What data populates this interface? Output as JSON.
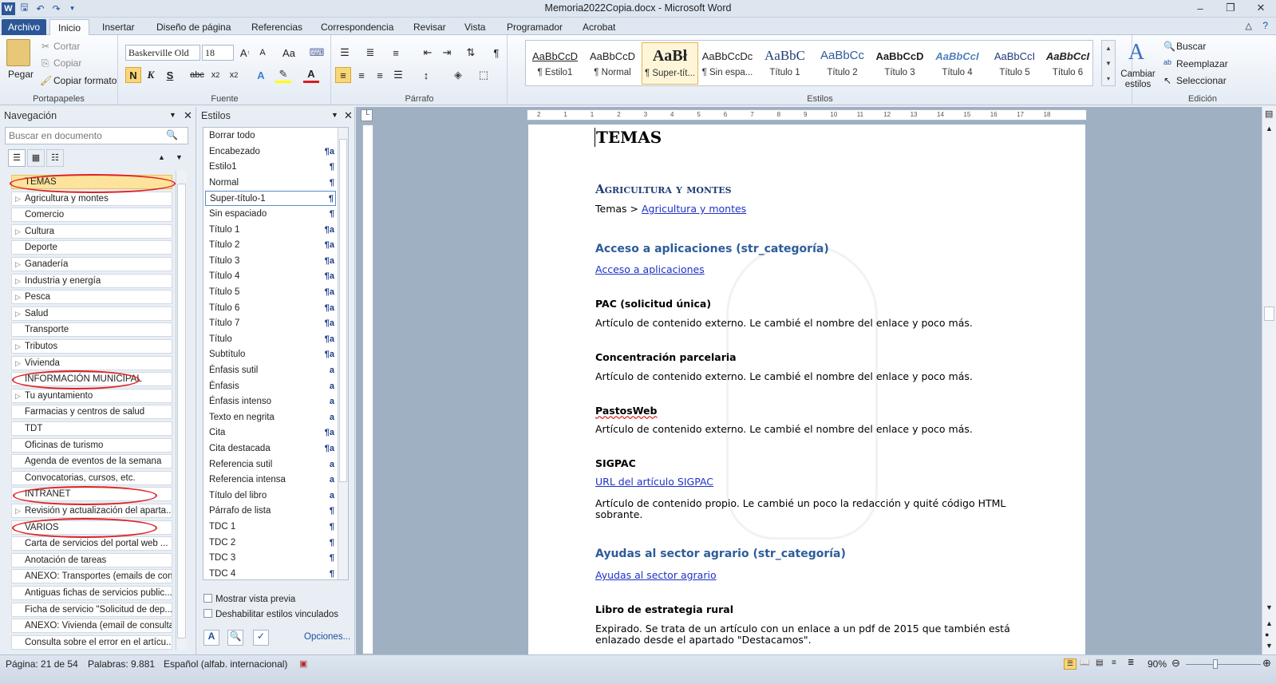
{
  "window": {
    "title": "Memoria2022Copia.docx - Microsoft Word"
  },
  "tabs": [
    "Archivo",
    "Inicio",
    "Insertar",
    "Diseño de página",
    "Referencias",
    "Correspondencia",
    "Revisar",
    "Vista",
    "Programador",
    "Acrobat"
  ],
  "clipboard": {
    "paste": "Pegar",
    "cut": "Cortar",
    "copy": "Copiar",
    "format_painter": "Copiar formato",
    "group": "Portapapeles"
  },
  "font": {
    "name": "Baskerville Old",
    "size": "18",
    "group": "Fuente"
  },
  "paragraph": {
    "group": "Párrafo"
  },
  "styles_gallery": {
    "group": "Estilos",
    "items": [
      {
        "sample": "AaBbCcD",
        "name": "¶ Estilo1"
      },
      {
        "sample": "AaBbCcD",
        "name": "¶ Normal"
      },
      {
        "sample": "AaBł",
        "name": "¶ Super-tít..."
      },
      {
        "sample": "AaBbCcDc",
        "name": "¶ Sin espa..."
      },
      {
        "sample": "AaBbC",
        "name": "Título 1"
      },
      {
        "sample": "AaBbCc",
        "name": "Título 2"
      },
      {
        "sample": "AaBbCcD",
        "name": "Título 3"
      },
      {
        "sample": "AaBbCcI",
        "name": "Título 4"
      },
      {
        "sample": "AaBbCcI",
        "name": "Título 5"
      },
      {
        "sample": "AaBbCcI",
        "name": "Título 6"
      }
    ],
    "change": "Cambiar estilos"
  },
  "editing": {
    "find": "Buscar",
    "replace": "Reemplazar",
    "select": "Seleccionar",
    "group": "Edición"
  },
  "navigation": {
    "title": "Navegación",
    "search_placeholder": "Buscar en documento",
    "items": [
      {
        "label": "TEMAS",
        "expand": false
      },
      {
        "label": "Agricultura y montes",
        "expand": true
      },
      {
        "label": "Comercio",
        "expand": false
      },
      {
        "label": "Cultura",
        "expand": true
      },
      {
        "label": "Deporte",
        "expand": false
      },
      {
        "label": "Ganadería",
        "expand": true
      },
      {
        "label": "Industria y energía",
        "expand": true
      },
      {
        "label": "Pesca",
        "expand": true
      },
      {
        "label": "Salud",
        "expand": true
      },
      {
        "label": "Transporte",
        "expand": false
      },
      {
        "label": "Tributos",
        "expand": true
      },
      {
        "label": "Vivienda",
        "expand": true
      },
      {
        "label": "INFORMACIÓN MUNICIPAL",
        "expand": false
      },
      {
        "label": "Tu ayuntamiento",
        "expand": true
      },
      {
        "label": "Farmacias y centros de salud",
        "expand": false
      },
      {
        "label": "TDT",
        "expand": false
      },
      {
        "label": "Oficinas de turismo",
        "expand": false
      },
      {
        "label": "Agenda de eventos de la semana",
        "expand": false
      },
      {
        "label": "Convocatorias, cursos, etc.",
        "expand": false
      },
      {
        "label": "INTRANET",
        "expand": false
      },
      {
        "label": "Revisión y actualización del aparta...",
        "expand": true
      },
      {
        "label": "VARIOS",
        "expand": false
      },
      {
        "label": "Carta de servicios del portal web ...",
        "expand": false
      },
      {
        "label": "Anotación de tareas",
        "expand": false
      },
      {
        "label": "ANEXO: Transportes (emails de con...",
        "expand": false
      },
      {
        "label": "Antiguas fichas de servicios public...",
        "expand": false
      },
      {
        "label": "Ficha de servicio \"Solicitud de dep...",
        "expand": false
      },
      {
        "label": "ANEXO: Vivienda (email de consulta)",
        "expand": false
      },
      {
        "label": "Consulta sobre el error en el artícu...",
        "expand": false
      }
    ]
  },
  "styles_pane": {
    "title": "Estilos",
    "items": [
      {
        "label": "Borrar todo",
        "mark": ""
      },
      {
        "label": "Encabezado",
        "mark": "¶a"
      },
      {
        "label": "Estilo1",
        "mark": "¶"
      },
      {
        "label": "Normal",
        "mark": "¶"
      },
      {
        "label": "Super-título-1",
        "mark": "¶"
      },
      {
        "label": "Sin espaciado",
        "mark": "¶"
      },
      {
        "label": "Título 1",
        "mark": "¶a"
      },
      {
        "label": "Título 2",
        "mark": "¶a"
      },
      {
        "label": "Título 3",
        "mark": "¶a"
      },
      {
        "label": "Título 4",
        "mark": "¶a"
      },
      {
        "label": "Título 5",
        "mark": "¶a"
      },
      {
        "label": "Título 6",
        "mark": "¶a"
      },
      {
        "label": "Título 7",
        "mark": "¶a"
      },
      {
        "label": "Título",
        "mark": "¶a"
      },
      {
        "label": "Subtítulo",
        "mark": "¶a"
      },
      {
        "label": "Énfasis sutil",
        "mark": "a"
      },
      {
        "label": "Énfasis",
        "mark": "a"
      },
      {
        "label": "Énfasis intenso",
        "mark": "a"
      },
      {
        "label": "Texto en negrita",
        "mark": "a"
      },
      {
        "label": "Cita",
        "mark": "¶a"
      },
      {
        "label": "Cita destacada",
        "mark": "¶a"
      },
      {
        "label": "Referencia sutil",
        "mark": "a"
      },
      {
        "label": "Referencia intensa",
        "mark": "a"
      },
      {
        "label": "Título del libro",
        "mark": "a"
      },
      {
        "label": "Párrafo de lista",
        "mark": "¶"
      },
      {
        "label": "TDC 1",
        "mark": "¶"
      },
      {
        "label": "TDC 2",
        "mark": "¶"
      },
      {
        "label": "TDC 3",
        "mark": "¶"
      },
      {
        "label": "TDC 4",
        "mark": "¶"
      }
    ],
    "preview": "Mostrar vista previa",
    "disable_linked": "Deshabilitar estilos vinculados",
    "options": "Opciones..."
  },
  "ruler_numbers": [
    "2",
    "1",
    "1",
    "2",
    "3",
    "4",
    "5",
    "6",
    "7",
    "8",
    "9",
    "10",
    "11",
    "12",
    "13",
    "14",
    "15",
    "16",
    "17",
    "18"
  ],
  "document": {
    "l1": "TEMAS",
    "l2": "Agricultura y montes",
    "l3a": "Temas > ",
    "l3b": "Agricultura y montes",
    "l4": "Acceso a aplicaciones (str_categoría)",
    "l5": "Acceso a aplicaciones",
    "l6": "PAC (solicitud única)",
    "l7": "Artículo de contenido externo. Le cambié el nombre del enlace y poco más.",
    "l8": "Concentración parcelaria",
    "l9": "Artículo de contenido externo. Le cambié el nombre del enlace y poco más.",
    "l10": "PastosWeb",
    "l11": "Artículo de contenido externo. Le cambié el nombre del enlace y poco más.",
    "l12": "SIGPAC",
    "l13": "URL del artículo SIGPAC",
    "l14": "Artículo de contenido propio. Le cambié un  poco la redacción y quité código HTML",
    "l15": "sobrante.",
    "l16": "Ayudas al sector agrario (str_categoría)",
    "l17": "Ayudas al sector agrario",
    "l18": "Libro de estrategia rural",
    "l19": "Expirado. Se trata de un artículo con un enlace a un pdf de 2015 que también está",
    "l20": "enlazado desde el apartado \"Destacamos\"."
  },
  "status": {
    "page": "Página: 21 de 54",
    "words": "Palabras: 9.881",
    "lang": "Español (alfab. internacional)",
    "zoom": "90%"
  }
}
